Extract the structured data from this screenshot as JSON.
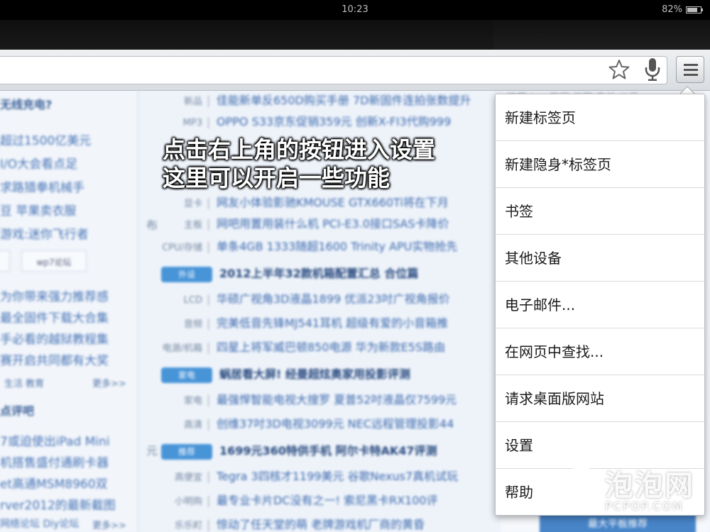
{
  "status_bar": {
    "time": "10:23",
    "battery": "82%"
  },
  "toolbar": {
    "star_icon": "star-icon",
    "mic_icon": "microphone-icon",
    "menu_icon": "hamburger-menu-icon"
  },
  "page": {
    "left": {
      "title": "无线充电?",
      "items": [
        "超过1500亿美元",
        "I/O大会看点足",
        "求路猎拳机械手",
        "豆 苹果卖衣服",
        "游戏:迷你飞行者"
      ],
      "tabs": [
        "",
        "wp7论坛"
      ],
      "items2": [
        "为你带来强力推荐感",
        "最全固件下载大合集",
        "手必看的越狱教程集",
        "赛开启共同都有大奖"
      ],
      "links": [
        "生活 教育",
        "更多>>"
      ],
      "section": "点评吧",
      "items3": [
        "7或迫使出iPad Mini",
        "机搭售盛付通刷卡器",
        "et高通MSM8960双",
        "rver2012的最新截图",
        "网络论坛 Diy论坛"
      ],
      "more": "更多>>"
    },
    "center": {
      "rows": [
        {
          "cat": "新品",
          "text": "佳能新单反650D购买手册 7D新固件连拍张数提升"
        },
        {
          "cat": "MP3",
          "text": "OPPO S33京东促销359元 创新X-FI3代购999"
        },
        {
          "cat": "",
          "text": ""
        },
        {
          "cat": "",
          "text": ""
        },
        {
          "cat": "显卡",
          "text": "网友小体验影驰KMOUSE GTX660Ti将在下月"
        },
        {
          "cat": "主板",
          "text": "网吧用置用装什么机 PCI-E3.0接口SAS卡降价"
        },
        {
          "cat": "CPU/存储",
          "text": "单条4GB 1333随超1600 Trinity APU实物抢先"
        }
      ],
      "feature1": {
        "badge": "外设",
        "text": "2012上半年32款机箱配置汇总 合位篇"
      },
      "rows2": [
        {
          "cat": "LCD",
          "text": "华硕广视角3D液晶1899 优派23吋广视角报价"
        },
        {
          "cat": "音频",
          "text": "完美低音先锋MJ541耳机 超级有爱的小音箱推"
        },
        {
          "cat": "电源/机箱",
          "text": "四星上将军威巴顿850电源 华为新款E5S路由"
        }
      ],
      "feature2": {
        "badge": "家电",
        "text": "蜗居看大屏! 经曼超炫奥家用投影评测"
      },
      "rows3": [
        {
          "cat": "家电",
          "text": "最强悍智能电视大搜罗 夏普52吋液晶仅7599元"
        },
        {
          "cat": "高清",
          "text": "创维37吋3D电视3099元 NEC远程管理投影44"
        }
      ],
      "feature3": {
        "badge": "推荐",
        "text": "1699元360特供手机 阿尔卡特AK47评测"
      },
      "rows4": [
        {
          "cat": "高便宜",
          "text": "Tegra 3四核才1199美元 谷歌Nexus7真机试玩"
        },
        {
          "cat": "小明购",
          "text": "最专业卡片DC没有之一! 索尼黑卡RX100评"
        },
        {
          "cat": "乐乐町",
          "text": "惊动了任天堂的萌 老牌游戏机厂商的黄昏"
        }
      ],
      "edge_char_1": "布",
      "edge_char_2": "元"
    },
    "right": {
      "top": "…推荐 | … 教程 华丽 表单 三月",
      "button": "最大平板推荐"
    }
  },
  "caption": {
    "line1": "点击右上角的按钮进入设置",
    "line2": "这里可以开启一些功能"
  },
  "menu": {
    "items": [
      "新建标签页",
      "新建隐身*标签页",
      "书签",
      "其他设备",
      "电子邮件...",
      "在网页中查找...",
      "请求桌面版网站",
      "设置",
      "帮助"
    ]
  },
  "watermark": {
    "title": "泡泡网",
    "url": "PCPOP.COM"
  }
}
